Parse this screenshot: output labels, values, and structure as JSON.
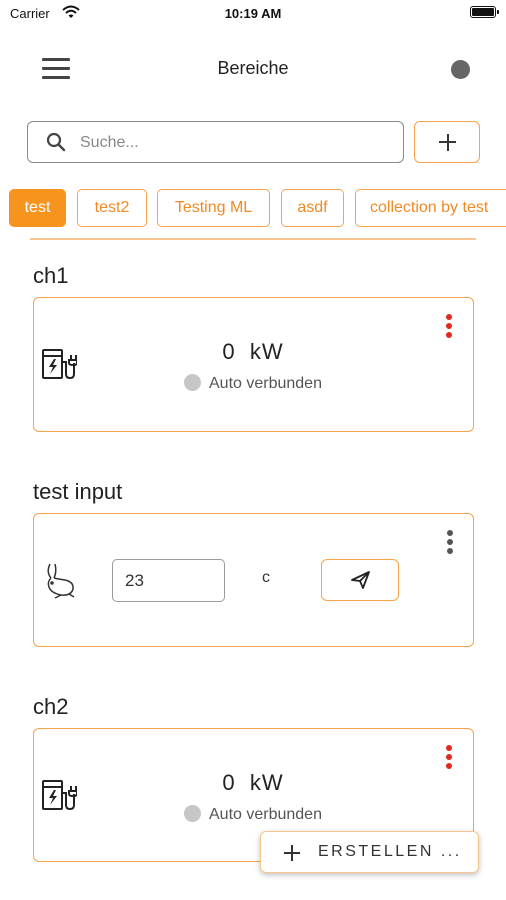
{
  "status_bar": {
    "carrier": "Carrier",
    "time": "10:19 AM"
  },
  "header": {
    "title": "Bereiche"
  },
  "search": {
    "placeholder": "Suche..."
  },
  "tags": [
    {
      "label": "test",
      "active": true
    },
    {
      "label": "test2",
      "active": false
    },
    {
      "label": "Testing ML",
      "active": false
    },
    {
      "label": "asdf",
      "active": false
    },
    {
      "label": "collection by test",
      "active": false
    }
  ],
  "sections": [
    {
      "title": "ch1",
      "power_value": "0",
      "power_unit": "kW",
      "status": "Auto verbunden"
    },
    {
      "title": "test input",
      "input_value": "23",
      "unit": "c"
    },
    {
      "title": "ch2",
      "power_value": "0",
      "power_unit": "kW",
      "status": "Auto verbunden"
    }
  ],
  "fab": {
    "label": "ERSTELLEN ..."
  },
  "colors": {
    "accent": "#f7941d",
    "accent_border": "#f7a24b",
    "kebab_alert": "#e0291f",
    "kebab_default": "#555555"
  },
  "icons": [
    "wifi-icon",
    "battery-icon",
    "menu-icon",
    "avatar-icon",
    "search-icon",
    "plus-icon",
    "ev-charger-icon",
    "more-vertical-icon",
    "rabbit-icon",
    "send-icon"
  ]
}
